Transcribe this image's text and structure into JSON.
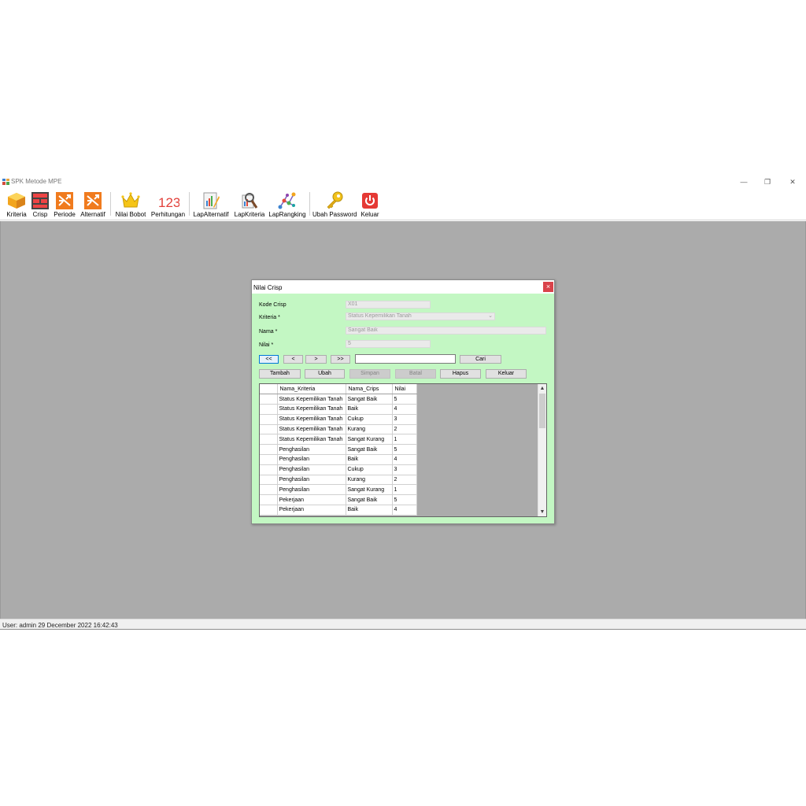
{
  "window": {
    "title": "SPK Metode MPE",
    "controls": {
      "minimize": "—",
      "restore": "❐",
      "close": "✕"
    }
  },
  "toolbar": {
    "items": [
      {
        "label": "Kriteria",
        "icon": "kriteria-icon"
      },
      {
        "label": "Crisp",
        "icon": "crisp-icon"
      },
      {
        "label": "Periode",
        "icon": "periode-icon"
      },
      {
        "label": "Alternatif",
        "icon": "alternatif-icon"
      },
      {
        "label": "Nilai Bobot",
        "icon": "crown-icon"
      },
      {
        "label": "Perhitungan",
        "icon": "numbers-icon"
      },
      {
        "label": "LapAlternatif",
        "icon": "report-chart-icon"
      },
      {
        "label": "LapKriteria",
        "icon": "report-search-icon"
      },
      {
        "label": "LapRangking",
        "icon": "network-icon"
      },
      {
        "label": "Ubah Password",
        "icon": "key-icon"
      },
      {
        "label": "Keluar",
        "icon": "power-icon"
      }
    ],
    "numbers_glyph": "123"
  },
  "dialog": {
    "title": "Nilai Crisp",
    "close": "×",
    "fields": {
      "kode_label": "Kode Crisp",
      "kode_value": "X01",
      "kriteria_label": "Kriteria *",
      "kriteria_value": "Status Kepemilikan Tanah",
      "nama_label": "Nama *",
      "nama_value": "Sangat Baik",
      "nilai_label": "Nilai *",
      "nilai_value": "5"
    },
    "nav": {
      "first": "<<",
      "prev": "<",
      "next": ">",
      "last": ">>",
      "search_value": "",
      "search_button": "Cari"
    },
    "actions": {
      "tambah": "Tambah",
      "ubah": "Ubah",
      "simpan": "Simpan",
      "batal": "Batal",
      "hapus": "Hapus",
      "keluar": "Keluar"
    },
    "grid": {
      "columns": [
        "Nama_Kriteria",
        "Nama_Crips",
        "Nilai"
      ],
      "rows": [
        [
          "Status Kepemilikan Tanah",
          "Sangat Baik",
          "5"
        ],
        [
          "Status Kepemilikan Tanah",
          "Baik",
          "4"
        ],
        [
          "Status Kepemilikan Tanah",
          "Cukup",
          "3"
        ],
        [
          "Status Kepemilikan Tanah",
          "Kurang",
          "2"
        ],
        [
          "Status Kepemilikan Tanah",
          "Sangat Kurang",
          "1"
        ],
        [
          "Penghasilan",
          "Sangat Baik",
          "5"
        ],
        [
          "Penghasilan",
          "Baik",
          "4"
        ],
        [
          "Penghasilan",
          "Cukup",
          "3"
        ],
        [
          "Penghasilan",
          "Kurang",
          "2"
        ],
        [
          "Penghasilan",
          "Sangat Kurang",
          "1"
        ],
        [
          "Pekerjaan",
          "Sangat Baik",
          "5"
        ],
        [
          "Pekerjaan",
          "Baik",
          "4"
        ]
      ],
      "scroll_up": "▲",
      "scroll_down": "▼"
    }
  },
  "status": {
    "text": "User: admin  29 December 2022 16:42:43"
  },
  "colors": {
    "dialog_bg": "#c3f7c3",
    "mdi_bg": "#ababab",
    "close_red": "#d9434b",
    "accent_blue": "#0078d7"
  }
}
